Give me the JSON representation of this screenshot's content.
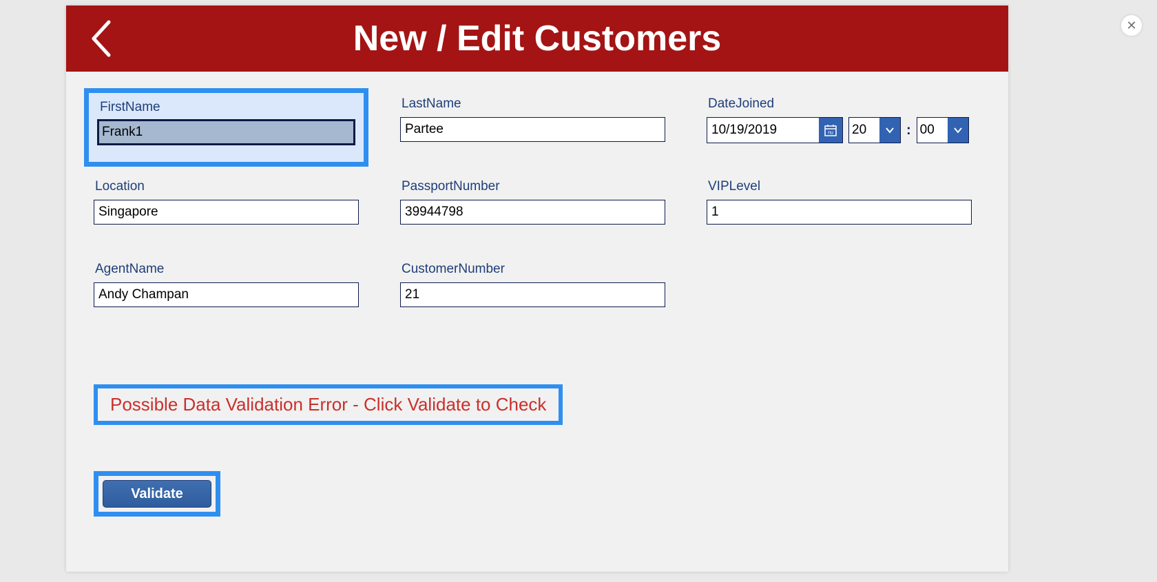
{
  "close_label": "✕",
  "header": {
    "title": "New / Edit Customers"
  },
  "fields": {
    "firstName": {
      "label": "FirstName",
      "value": "Frank1"
    },
    "lastName": {
      "label": "LastName",
      "value": "Partee"
    },
    "dateJoined": {
      "label": "DateJoined",
      "date": "10/19/2019",
      "hour": "20",
      "minute": "00",
      "separator": ":"
    },
    "location": {
      "label": "Location",
      "value": "Singapore"
    },
    "passportNumber": {
      "label": "PassportNumber",
      "value": "39944798"
    },
    "vipLevel": {
      "label": "VIPLevel",
      "value": "1"
    },
    "agentName": {
      "label": "AgentName",
      "value": "Andy Champan"
    },
    "customerNumber": {
      "label": "CustomerNumber",
      "value": "21"
    }
  },
  "warning_text": "Possible Data Validation Error - Click Validate to Check",
  "buttons": {
    "validate": "Validate"
  }
}
